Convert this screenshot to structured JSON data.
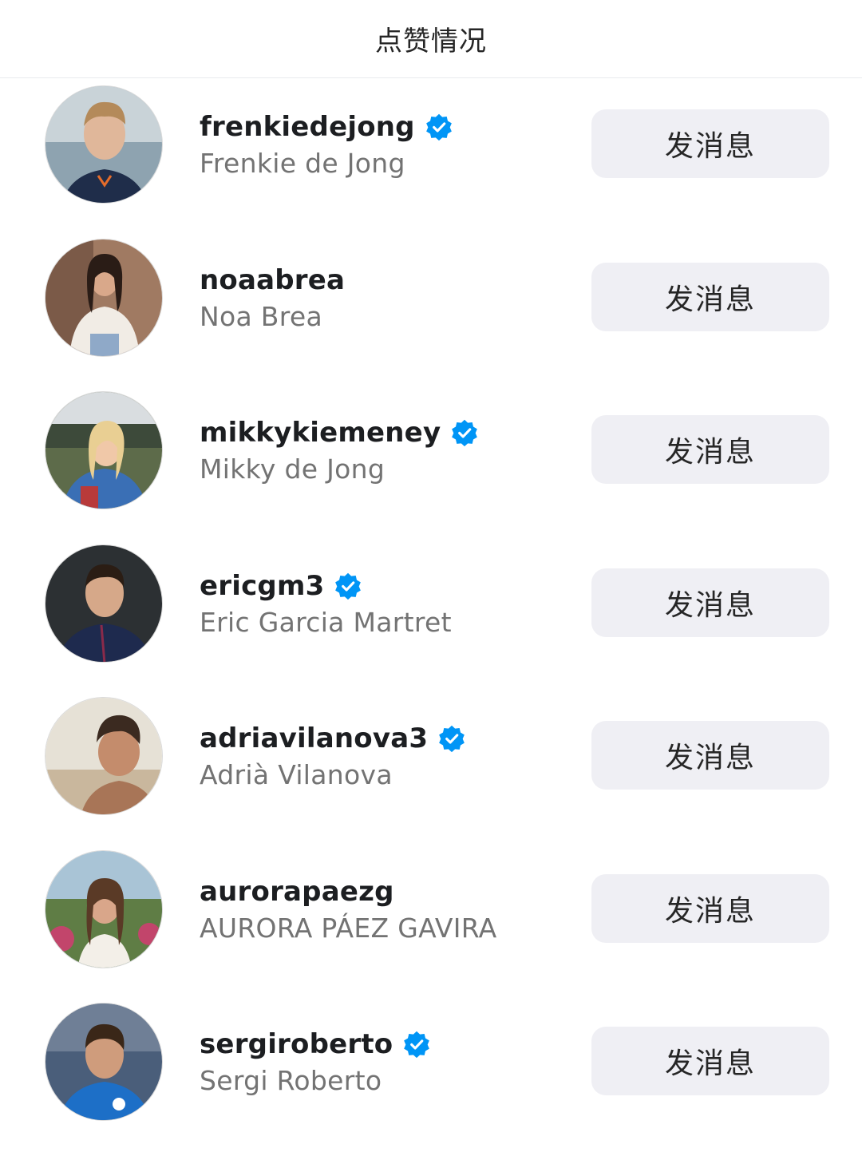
{
  "header": {
    "title": "点赞情况"
  },
  "colors": {
    "verified": "#0095f6",
    "button_bg": "#efeff4",
    "fullname": "#737373"
  },
  "likes": [
    {
      "username": "frenkiedejong",
      "full_name": "Frenkie de Jong",
      "verified": true,
      "button": "发消息"
    },
    {
      "username": "noaabrea",
      "full_name": "Noa Brea",
      "verified": false,
      "button": "发消息"
    },
    {
      "username": "mikkykiemeney",
      "full_name": "Mikky de Jong",
      "verified": true,
      "button": "发消息"
    },
    {
      "username": "ericgm3",
      "full_name": "Eric Garcia Martret",
      "verified": true,
      "button": "发消息"
    },
    {
      "username": "adriavilanova3",
      "full_name": "Adrià Vilanova",
      "verified": true,
      "button": "发消息"
    },
    {
      "username": "aurorapaezg",
      "full_name": "AURORA PÁEZ GAVIRA",
      "verified": false,
      "button": "发消息"
    },
    {
      "username": "sergiroberto",
      "full_name": "Sergi Roberto",
      "verified": true,
      "button": "发消息"
    }
  ]
}
